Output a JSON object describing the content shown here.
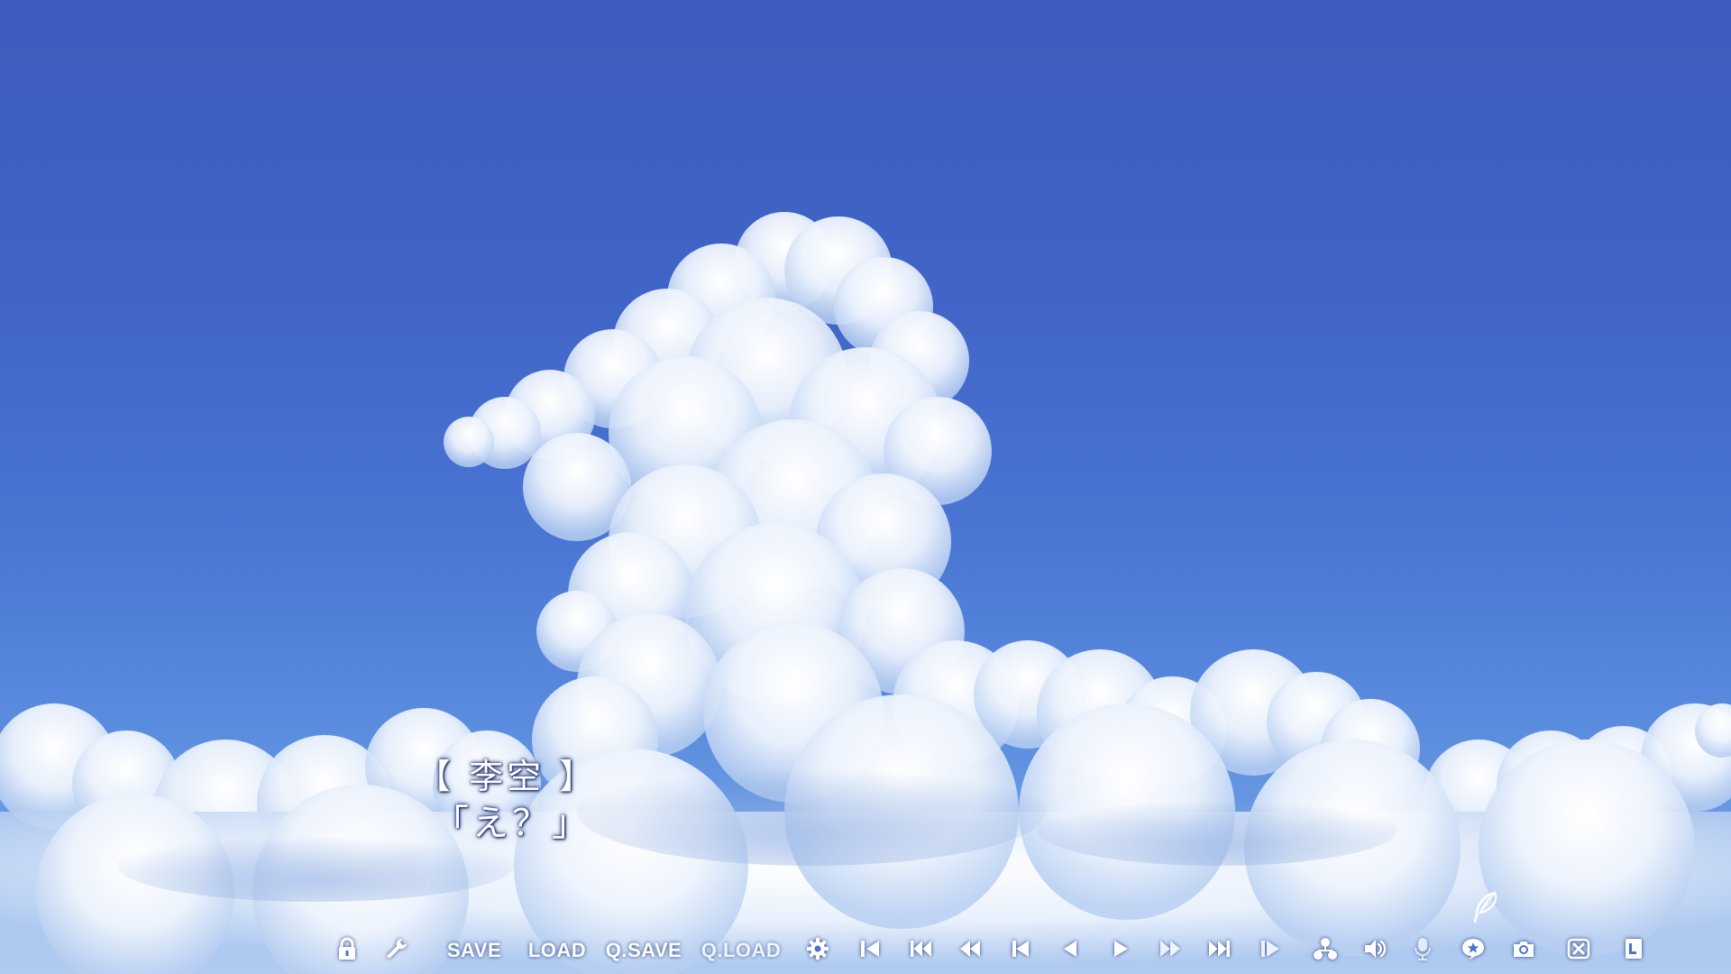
{
  "dialogue": {
    "speaker": "【 李空 】",
    "line": "「え？」"
  },
  "toolbar": {
    "save_label": "SAVE",
    "load_label": "LOAD",
    "qsave_label": "Q.SAVE",
    "qload_label": "Q.LOAD"
  },
  "colors": {
    "sky_top": "#3d5cbf",
    "sky_bottom": "#7fb0ea",
    "cloud": "#ffffff",
    "text": "#ffffff",
    "text_outline": "#1a2b6b"
  },
  "icons": [
    "lock-icon",
    "wrench-icon",
    "gear-icon",
    "prev-choice-icon",
    "skip-back-icon",
    "rewind-icon",
    "prev-scene-icon",
    "back-icon",
    "play-icon",
    "fast-forward-icon",
    "skip-forward-icon",
    "next-choice-icon",
    "flowchart-icon",
    "volume-icon",
    "microphone-icon",
    "star-bubble-icon",
    "camera-icon",
    "close-window-icon",
    "backlog-icon",
    "feather-icon"
  ]
}
